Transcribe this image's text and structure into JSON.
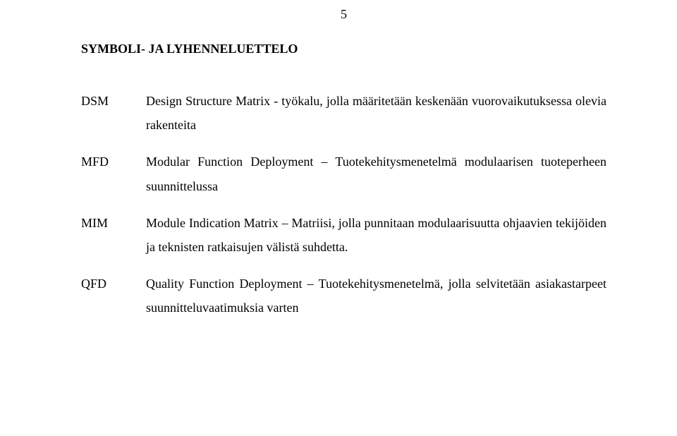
{
  "page_number": "5",
  "heading": "SYMBOLI- JA LYHENNELUETTELO",
  "entries": [
    {
      "abbr": "DSM",
      "definition": "Design Structure Matrix - työkalu, jolla määritetään keskenään vuorovaikutuksessa olevia rakenteita"
    },
    {
      "abbr": "MFD",
      "definition": "Modular Function Deployment – Tuotekehitysmenetelmä modulaarisen tuoteperheen suunnittelussa"
    },
    {
      "abbr": "MIM",
      "definition": "Module Indication Matrix – Matriisi, jolla punnitaan modulaarisuutta ohjaavien tekijöiden ja teknisten ratkaisujen välistä suhdetta."
    },
    {
      "abbr": "QFD",
      "definition": "Quality Function Deployment – Tuotekehitysmenetelmä, jolla selvitetään asiakastarpeet suunnitteluvaatimuksia varten"
    }
  ]
}
